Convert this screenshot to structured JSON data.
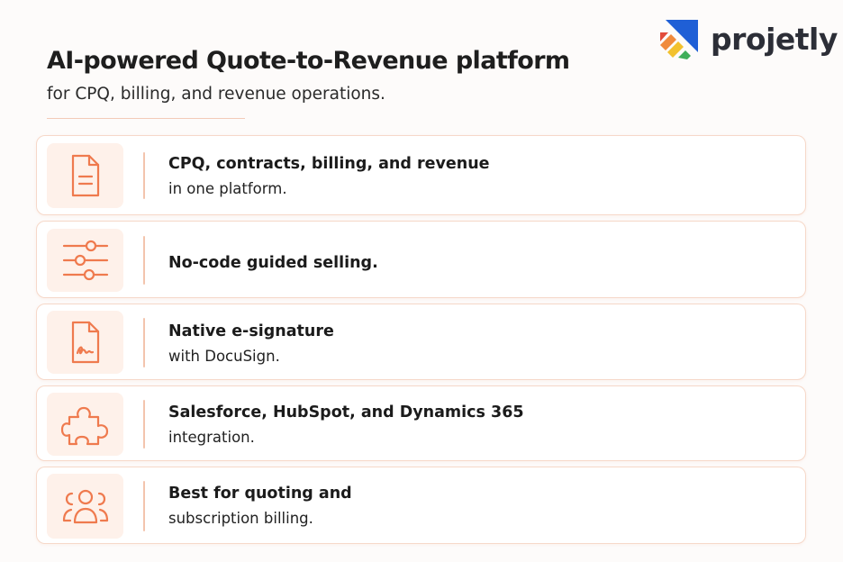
{
  "header": {
    "title": "AI-powered Quote-to-Revenue platform",
    "subtitle": "for CPQ, billing, and revenue operations."
  },
  "brand": {
    "name": "projetly",
    "colors": {
      "blue": "#1f5fd6",
      "orange": "#f08a3c",
      "red": "#e24b3b",
      "green": "#3fae5a",
      "yellow": "#f2c12e"
    }
  },
  "accent_color": "#ef7a4e",
  "features": [
    {
      "icon": "document-icon",
      "line1": "CPQ, contracts, billing, and revenue",
      "line2": "in one platform."
    },
    {
      "icon": "sliders-icon",
      "line1": "No-code guided selling.",
      "line2": ""
    },
    {
      "icon": "signature-document-icon",
      "line1": "Native e-signature",
      "line2": "with DocuSign."
    },
    {
      "icon": "puzzle-icon",
      "line1": "Salesforce, HubSpot, and Dynamics 365",
      "line2": "integration."
    },
    {
      "icon": "users-icon",
      "line1": "Best for quoting and",
      "line2": "subscription billing."
    }
  ]
}
